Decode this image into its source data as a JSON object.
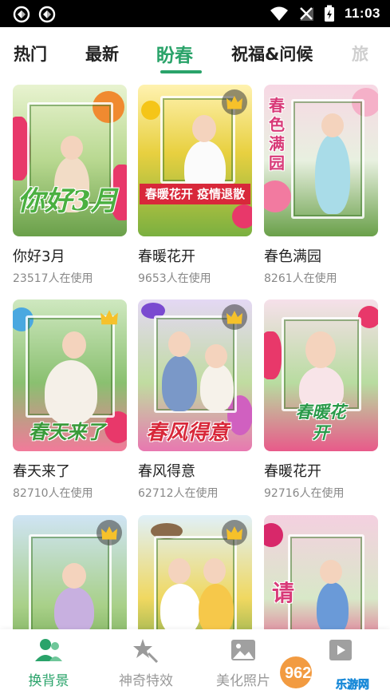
{
  "status_bar": {
    "time": "11:03"
  },
  "tabs": [
    {
      "label": "热门",
      "state": "normal"
    },
    {
      "label": "最新",
      "state": "normal"
    },
    {
      "label": "盼春",
      "state": "active"
    },
    {
      "label": "祝福&问候",
      "state": "normal"
    },
    {
      "label": "旅",
      "state": "faded"
    }
  ],
  "cards": [
    {
      "title": "你好3月",
      "count": "23517人在使用",
      "premium": false,
      "overlay_text": "你好3月"
    },
    {
      "title": "春暖花开",
      "count": "9653人在使用",
      "premium": true,
      "overlay_text": "春暖花开 疫情退散"
    },
    {
      "title": "春色满园",
      "count": "8261人在使用",
      "premium": false,
      "overlay_text": "春色满园"
    },
    {
      "title": "春天来了",
      "count": "82710人在使用",
      "premium": true,
      "overlay_text": "春天来了"
    },
    {
      "title": "春风得意",
      "count": "62712人在使用",
      "premium": true,
      "overlay_text": "春风得意"
    },
    {
      "title": "春暖花开",
      "count": "92716人在使用",
      "premium": false,
      "overlay_text": "春暖花开"
    },
    {
      "title": "",
      "count": "",
      "premium": true,
      "overlay_text": ""
    },
    {
      "title": "",
      "count": "",
      "premium": true,
      "overlay_text": ""
    },
    {
      "title": "",
      "count": "",
      "premium": false,
      "overlay_text": "请"
    }
  ],
  "bottom_nav": [
    {
      "label": "换背景",
      "icon": "people-icon",
      "active": true
    },
    {
      "label": "神奇特效",
      "icon": "magic-star-icon",
      "active": false
    },
    {
      "label": "美化照片",
      "icon": "image-icon",
      "active": false
    }
  ],
  "watermark": {
    "text": "962.NET",
    "subtext": "乐游网"
  },
  "colors": {
    "accent": "#2aa36a",
    "text": "#222222",
    "muted": "#888888"
  }
}
